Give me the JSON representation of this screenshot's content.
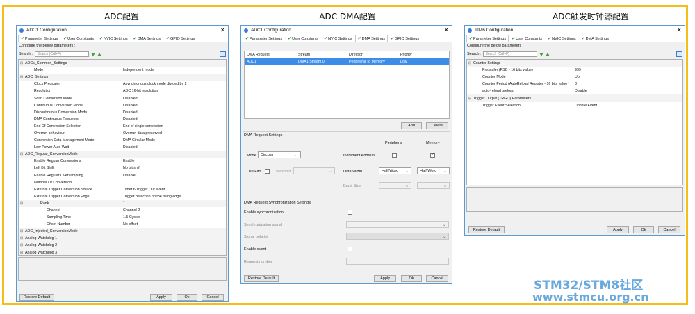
{
  "sections": {
    "adc": "ADC配置",
    "dma": "ADC DMA配置",
    "tim": "ADC触发时钟源配置"
  },
  "watermark": {
    "line1": "STM32/STM8社区",
    "line2": "www.stmcu.org.cn"
  },
  "adc_window": {
    "title": "ADC1 Configuration",
    "close": "✕",
    "tabs": [
      "Parameter Settings",
      "User Constants",
      "NVIC Settings",
      "DMA Settings",
      "GPIO Settings"
    ],
    "configure": "Configure the below parameters :",
    "search_label": "Search :",
    "search_placeholder": "Search (Crtl+F)",
    "params": [
      {
        "name": "ADCs_Common_Settings",
        "value": "",
        "level": 0,
        "group": true
      },
      {
        "name": "Mode",
        "value": "Independent mode",
        "level": 2
      },
      {
        "name": "ADC_Settings",
        "value": "",
        "level": 0,
        "group": true
      },
      {
        "name": "Clock Prescaler",
        "value": "Asynchronous clock mode divided by 2",
        "level": 2
      },
      {
        "name": "Resolution",
        "value": "ADC 16-bit resolution",
        "level": 2
      },
      {
        "name": "Scan Conversion Mode",
        "value": "Disabled",
        "level": 2
      },
      {
        "name": "Continuous Conversion Mode",
        "value": "Disabled",
        "level": 2
      },
      {
        "name": "Discontinuous Conversion Mode",
        "value": "Disabled",
        "level": 2
      },
      {
        "name": "DMA Continuous Requests",
        "value": "Disabled",
        "level": 2
      },
      {
        "name": "End Of Conversion Selection",
        "value": "End of single conversion",
        "level": 2
      },
      {
        "name": "Overrun behaviour",
        "value": "Overrun data preserved",
        "level": 2
      },
      {
        "name": "Conversion Data Management Mode",
        "value": "DMA Circular Mode",
        "level": 2
      },
      {
        "name": "Low Power Auto Wait",
        "value": "Disabled",
        "level": 2
      },
      {
        "name": "ADC_Regular_ConversionMode",
        "value": "",
        "level": 0,
        "group": true
      },
      {
        "name": "Enable Regular Conversions",
        "value": "Enable",
        "level": 2
      },
      {
        "name": "Left Bit Shift",
        "value": "No bit shift",
        "level": 2
      },
      {
        "name": "Enable Regular Oversampling",
        "value": "Disable",
        "level": 2
      },
      {
        "name": "Number Of Conversion",
        "value": "1",
        "level": 2
      },
      {
        "name": "External Trigger Conversion Source",
        "value": "Timer 6 Trigger Out event",
        "level": 2
      },
      {
        "name": "External Trigger Conversion Edge",
        "value": "Trigger detection on the rising edge",
        "level": 2
      },
      {
        "name": "Rank",
        "value": "1",
        "level": 3,
        "group": true
      },
      {
        "name": "Channel",
        "value": "Channel 2",
        "level": 4
      },
      {
        "name": "Sampling Time",
        "value": "1.5 Cycles",
        "level": 4
      },
      {
        "name": "Offset Number",
        "value": "No offset",
        "level": 4
      },
      {
        "name": "ADC_Injected_ConversionMode",
        "value": "",
        "level": 0,
        "group": true,
        "collapsed": true
      },
      {
        "name": "Analog Watchdog 1",
        "value": "",
        "level": 0,
        "group": true,
        "collapsed": true
      },
      {
        "name": "Analog Watchdog 2",
        "value": "",
        "level": 0,
        "group": true,
        "collapsed": true
      },
      {
        "name": "Analog Watchdog 3",
        "value": "",
        "level": 0,
        "group": true,
        "collapsed": true
      }
    ],
    "buttons": {
      "restore": "Restore Default",
      "apply": "Apply",
      "ok": "Ok",
      "cancel": "Cancel"
    }
  },
  "dma_window": {
    "title": "ADC1 Configuration",
    "close": "✕",
    "tabs": [
      "Parameter Settings",
      "User Constants",
      "NVIC Settings",
      "DMA Settings",
      "GPIO Settings"
    ],
    "table_headers": [
      "DMA Request",
      "Stream",
      "Direction",
      "Priority"
    ],
    "table_row": [
      "ADC1",
      "DMA1 Stream 0",
      "Peripheral To Memory",
      "Low"
    ],
    "add": "Add",
    "delete": "Delete",
    "req_settings": "DMA Request Settings",
    "peripheral": "Peripheral",
    "memory": "Memory",
    "mode_label": "Mode",
    "mode_value": "Circular",
    "increment_label": "Increment Address",
    "increment_peripheral": false,
    "increment_memory": true,
    "use_fifo": "Use Fifo",
    "threshold": "Threshold",
    "data_width": "Data Width",
    "periph_width": "Half Word",
    "mem_width": "Half Word",
    "burst_size": "Burst Size",
    "sync_settings": "DMA Request Synchronization Settings",
    "enable_sync": "Enable synchronization",
    "sync_signal": "Synchronization signal",
    "signal_polarity": "Signal polarity",
    "enable_event": "Enable event",
    "request_number": "Request number",
    "buttons": {
      "restore": "Restore Default",
      "apply": "Apply",
      "ok": "Ok",
      "cancel": "Cancel"
    }
  },
  "tim_window": {
    "title": "TIM6 Configuration",
    "close": "✕",
    "tabs": [
      "Parameter Settings",
      "User Constants",
      "NVIC Settings",
      "DMA Settings"
    ],
    "configure": "Configure the below parameters :",
    "search_label": "Search :",
    "search_placeholder": "Search (Crtl+F)",
    "params": [
      {
        "name": "Counter Settings",
        "value": "",
        "level": 0,
        "group": true
      },
      {
        "name": "Prescaler (PSC - 16 bits value)",
        "value": "999",
        "level": 2
      },
      {
        "name": "Counter Mode",
        "value": "Up",
        "level": 2
      },
      {
        "name": "Counter Period (AutoReload Register - 16 bits value )",
        "value": "3",
        "level": 2
      },
      {
        "name": "auto-reload preload",
        "value": "Disable",
        "level": 2
      },
      {
        "name": "Trigger Output (TRGO) Parameters",
        "value": "",
        "level": 0,
        "group": true
      },
      {
        "name": "Trigger Event Selection",
        "value": "Update Event",
        "level": 2
      }
    ],
    "buttons": {
      "restore": "Restore Default",
      "apply": "Apply",
      "ok": "Ok",
      "cancel": "Cancel"
    }
  }
}
